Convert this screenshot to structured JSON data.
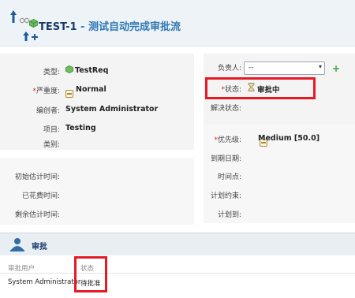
{
  "header": {
    "item_id": "TEST-1",
    "separator": " - ",
    "item_title": "测试自动完成审批流"
  },
  "fields": {
    "type": {
      "label": "类型:",
      "value": "TestReq"
    },
    "severity": {
      "label": "严重度:",
      "value": "Normal"
    },
    "author": {
      "label": "编创者:",
      "value": "System Administrator"
    },
    "project": {
      "label": "项目:",
      "value": "Testing"
    },
    "category": {
      "label": "类别:",
      "value": ""
    },
    "assignee": {
      "label": "负责人:",
      "value": "--"
    },
    "status": {
      "label": "状态:",
      "value": "审批中"
    },
    "resolution": {
      "label": "解决状态:",
      "value": ""
    },
    "priority": {
      "label": "优先级:",
      "value": "Medium [50.0]"
    },
    "due_date": {
      "label": "到期日期:",
      "value": ""
    },
    "initial_estimate": {
      "label": "初始估计时间:",
      "value": ""
    },
    "time_spent": {
      "label": "已花费时间:",
      "value": ""
    },
    "remaining_estimate": {
      "label": "剩余估计时间:",
      "value": ""
    },
    "time_point": {
      "label": "时间点:",
      "value": ""
    },
    "plan_constraint": {
      "label": "计划约束:",
      "value": ""
    },
    "plan_to": {
      "label": "计划到:",
      "value": ""
    }
  },
  "required_mark": "*",
  "approval": {
    "section_title": "审批",
    "col_user": "审批用户",
    "col_status": "状态",
    "rows": [
      {
        "user": "System Administrator",
        "status": "待批准"
      }
    ]
  },
  "colors": {
    "highlight": "#e41b24",
    "title": "#1a3a6b",
    "accent": "#2f78b4"
  }
}
